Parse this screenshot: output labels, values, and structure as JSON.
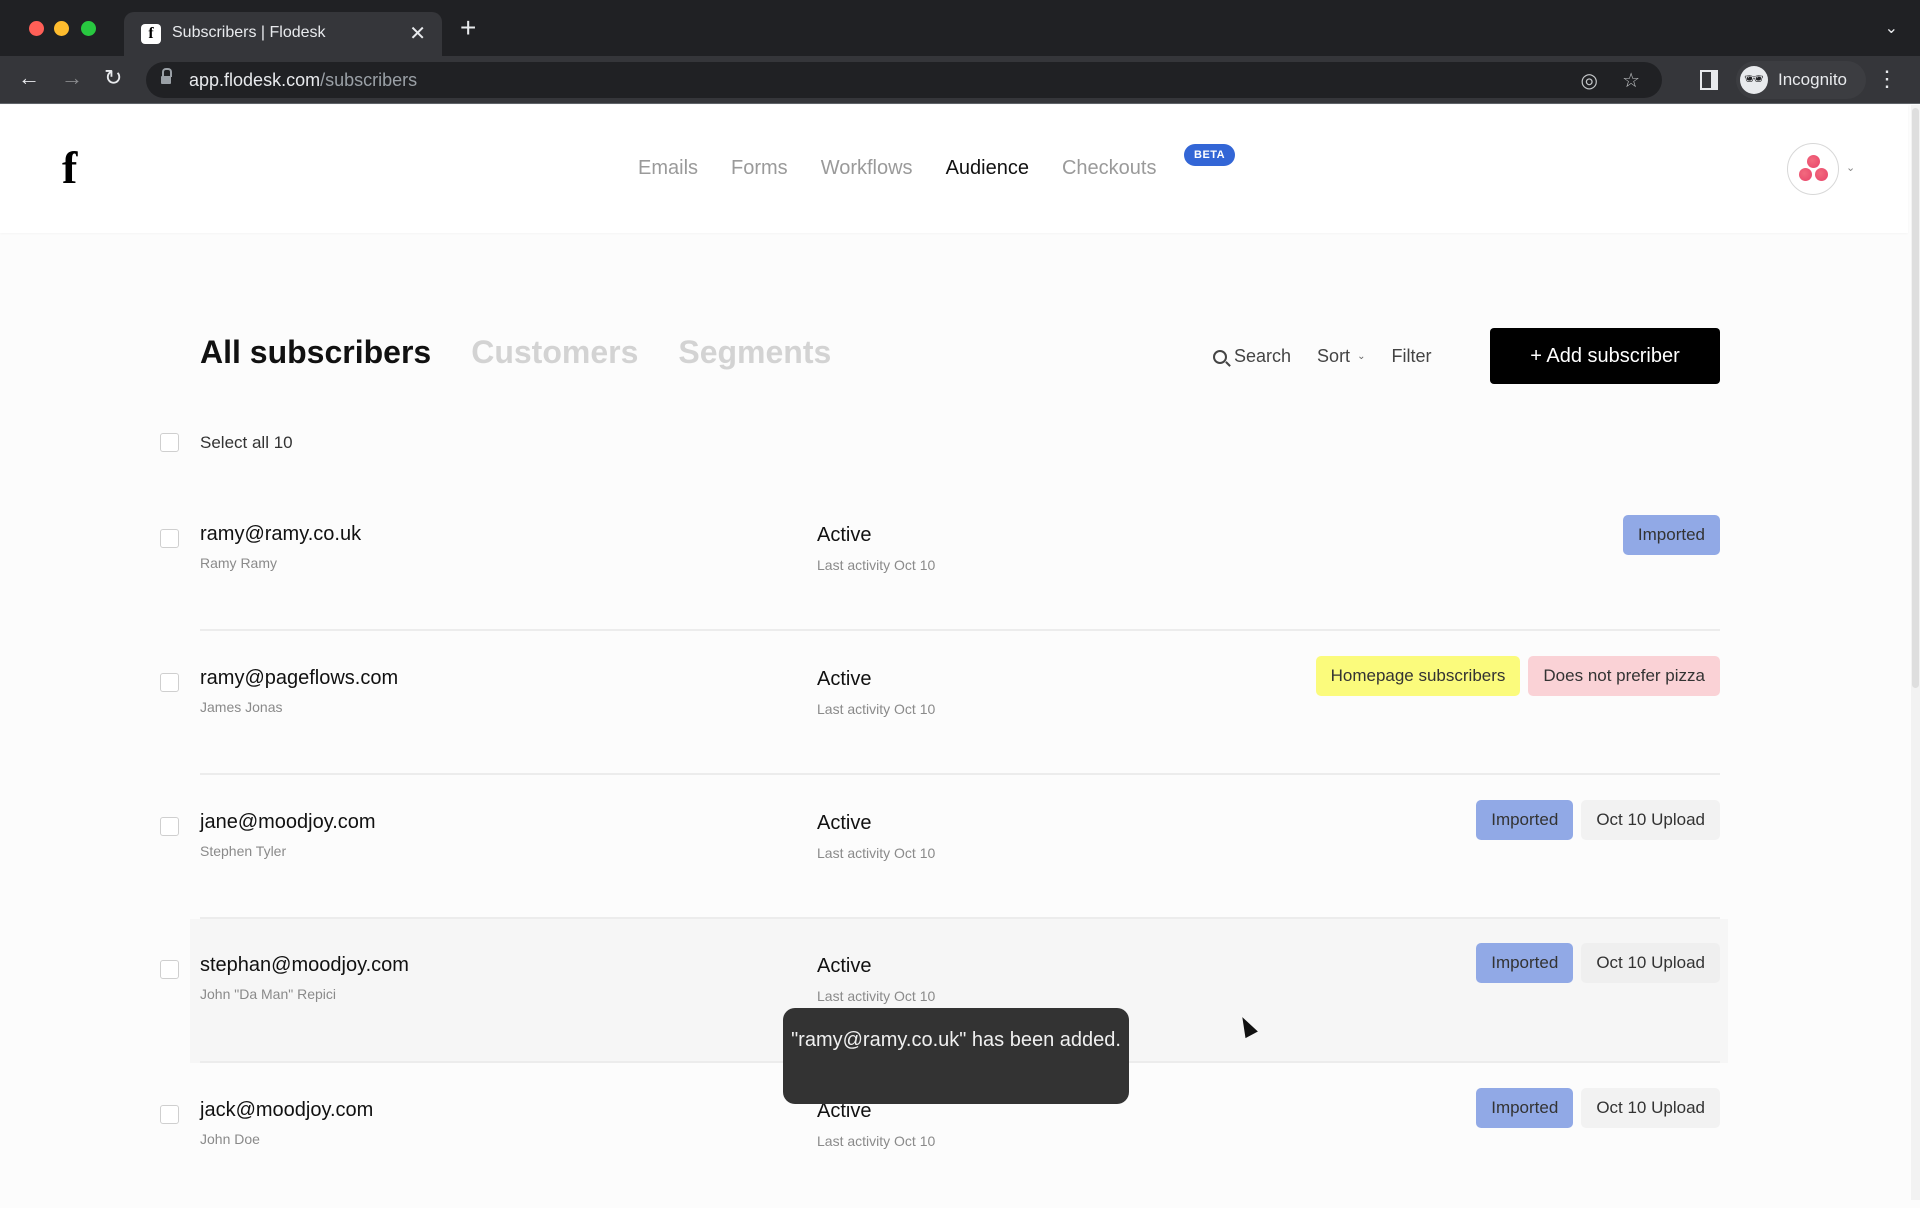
{
  "browser": {
    "tab_title": "Subscribers | Flodesk",
    "tab_favicon": "f",
    "url_domain": "app.flodesk.com",
    "url_path": "/subscribers",
    "profile_label": "Incognito",
    "icons": {
      "back": "←",
      "forward": "→",
      "reload": "↻",
      "close_tab": "✕",
      "new_tab": "+",
      "tab_menu": "⌄",
      "eye_off": "◎",
      "star": "☆",
      "incognito": "🕶",
      "more": "⋮"
    }
  },
  "header": {
    "logo": "f",
    "nav": [
      {
        "label": "Emails",
        "active": false
      },
      {
        "label": "Forms",
        "active": false
      },
      {
        "label": "Workflows",
        "active": false
      },
      {
        "label": "Audience",
        "active": true
      },
      {
        "label": "Checkouts",
        "active": false,
        "badge": "BETA"
      }
    ],
    "account_chevron": "⌄"
  },
  "page": {
    "tabs": [
      {
        "label": "All subscribers",
        "active": true
      },
      {
        "label": "Customers",
        "active": false
      },
      {
        "label": "Segments",
        "active": false
      }
    ],
    "actions": {
      "search": "Search",
      "sort": "Sort",
      "sort_chevron": "⌄",
      "filter": "Filter",
      "add_subscriber": "+ Add subscriber"
    },
    "select_all": "Select all 10"
  },
  "colors": {
    "tag_imported": "#91a9e6",
    "tag_upload": "#f2f2f2",
    "tag_homepage": "#fbfb7c",
    "tag_pizza": "#fad2d6",
    "beta_badge": "#3366d6"
  },
  "subscribers": [
    {
      "email": "ramy@ramy.co.uk",
      "name": "Ramy Ramy",
      "status": "Active",
      "last_activity": "Last activity Oct 10",
      "tags": [
        {
          "label": "Imported",
          "color": "#91a9e6"
        }
      ]
    },
    {
      "email": "ramy@pageflows.com",
      "name": "James Jonas",
      "status": "Active",
      "last_activity": "Last activity Oct 10",
      "tags": [
        {
          "label": "Homepage subscribers",
          "color": "#fbfb7c"
        },
        {
          "label": "Does not prefer pizza",
          "color": "#fad2d6"
        }
      ]
    },
    {
      "email": "jane@moodjoy.com",
      "name": "Stephen Tyler",
      "status": "Active",
      "last_activity": "Last activity Oct 10",
      "tags": [
        {
          "label": "Imported",
          "color": "#91a9e6"
        },
        {
          "label": "Oct 10 Upload",
          "color": "#f2f2f2"
        }
      ]
    },
    {
      "email": "stephan@moodjoy.com",
      "name": "John \"Da Man\" Repici",
      "status": "Active",
      "last_activity": "Last activity Oct 10",
      "tags": [
        {
          "label": "Imported",
          "color": "#91a9e6"
        },
        {
          "label": "Oct 10 Upload",
          "color": "#f2f2f2"
        }
      ]
    },
    {
      "email": "jack@moodjoy.com",
      "name": "John Doe",
      "status": "Active",
      "last_activity": "Last activity Oct 10",
      "tags": [
        {
          "label": "Imported",
          "color": "#91a9e6"
        },
        {
          "label": "Oct 10 Upload",
          "color": "#f2f2f2"
        }
      ]
    }
  ],
  "toast": {
    "message": "\"ramy@ramy.co.uk\" has been added."
  }
}
